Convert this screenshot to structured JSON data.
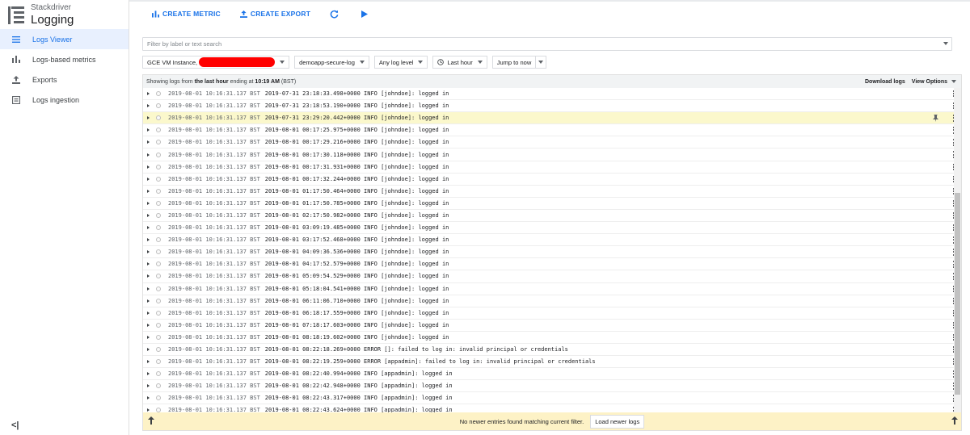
{
  "app": {
    "brand_sub": "Stackdriver",
    "brand_title": "Logging"
  },
  "sidebar": {
    "items": [
      {
        "label": "Logs Viewer",
        "icon": "list-icon",
        "active": true
      },
      {
        "label": "Logs-based metrics",
        "icon": "bar-chart-icon",
        "active": false
      },
      {
        "label": "Exports",
        "icon": "export-icon",
        "active": false
      },
      {
        "label": "Logs ingestion",
        "icon": "ingestion-icon",
        "active": false
      }
    ],
    "collapse_label": "<|"
  },
  "toolbar": {
    "create_metric": "CREATE METRIC",
    "create_export": "CREATE EXPORT"
  },
  "filter": {
    "placeholder": "Filter by label or text search"
  },
  "selects": {
    "resource": "GCE VM Instance,",
    "log": "demoapp-secure-log",
    "level": "Any log level",
    "time": "Last hour",
    "jump": "Jump to now"
  },
  "log_header": {
    "prefix": "Showing logs from",
    "range": "the last hour",
    "middle": "ending at",
    "time": "10:19 AM",
    "tz": "(BST)",
    "download": "Download logs",
    "view_options": "View Options"
  },
  "rows": [
    {
      "ts": "2019-08-01 10:16:31.137 BST",
      "msg": "2019-07-31 23:18:33.498+0000 INFO [johndoe]: logged in"
    },
    {
      "ts": "2019-08-01 10:16:31.137 BST",
      "msg": "2019-07-31 23:18:53.190+0000 INFO [johndoe]: logged in"
    },
    {
      "ts": "2019-08-01 10:16:31.137 BST",
      "msg": "2019-07-31 23:29:20.442+0000 INFO [johndoe]: logged in",
      "highlight": true
    },
    {
      "ts": "2019-08-01 10:16:31.137 BST",
      "msg": "2019-08-01 00:17:25.975+0000 INFO [johndoe]: logged in"
    },
    {
      "ts": "2019-08-01 10:16:31.137 BST",
      "msg": "2019-08-01 00:17:29.216+0000 INFO [johndoe]: logged in"
    },
    {
      "ts": "2019-08-01 10:16:31.137 BST",
      "msg": "2019-08-01 00:17:30.118+0000 INFO [johndoe]: logged in"
    },
    {
      "ts": "2019-08-01 10:16:31.137 BST",
      "msg": "2019-08-01 00:17:31.931+0000 INFO [johndoe]: logged in"
    },
    {
      "ts": "2019-08-01 10:16:31.137 BST",
      "msg": "2019-08-01 00:17:32.244+0000 INFO [johndoe]: logged in"
    },
    {
      "ts": "2019-08-01 10:16:31.137 BST",
      "msg": "2019-08-01 01:17:50.464+0000 INFO [johndoe]: logged in"
    },
    {
      "ts": "2019-08-01 10:16:31.137 BST",
      "msg": "2019-08-01 01:17:50.785+0000 INFO [johndoe]: logged in"
    },
    {
      "ts": "2019-08-01 10:16:31.137 BST",
      "msg": "2019-08-01 02:17:50.982+0000 INFO [johndoe]: logged in"
    },
    {
      "ts": "2019-08-01 10:16:31.137 BST",
      "msg": "2019-08-01 03:09:19.485+0000 INFO [johndoe]: logged in"
    },
    {
      "ts": "2019-08-01 10:16:31.137 BST",
      "msg": "2019-08-01 03:17:52.468+0000 INFO [johndoe]: logged in"
    },
    {
      "ts": "2019-08-01 10:16:31.137 BST",
      "msg": "2019-08-01 04:09:36.536+0000 INFO [johndoe]: logged in"
    },
    {
      "ts": "2019-08-01 10:16:31.137 BST",
      "msg": "2019-08-01 04:17:52.579+0000 INFO [johndoe]: logged in"
    },
    {
      "ts": "2019-08-01 10:16:31.137 BST",
      "msg": "2019-08-01 05:09:54.529+0000 INFO [johndoe]: logged in"
    },
    {
      "ts": "2019-08-01 10:16:31.137 BST",
      "msg": "2019-08-01 05:18:04.541+0000 INFO [johndoe]: logged in"
    },
    {
      "ts": "2019-08-01 10:16:31.137 BST",
      "msg": "2019-08-01 06:11:06.710+0000 INFO [johndoe]: logged in"
    },
    {
      "ts": "2019-08-01 10:16:31.137 BST",
      "msg": "2019-08-01 06:18:17.559+0000 INFO [johndoe]: logged in"
    },
    {
      "ts": "2019-08-01 10:16:31.137 BST",
      "msg": "2019-08-01 07:18:17.603+0000 INFO [johndoe]: logged in"
    },
    {
      "ts": "2019-08-01 10:16:31.137 BST",
      "msg": "2019-08-01 08:18:19.602+0000 INFO [johndoe]: logged in"
    },
    {
      "ts": "2019-08-01 10:16:31.137 BST",
      "msg": "2019-08-01 08:22:18.269+0000 ERROR []: failed to log in: invalid principal or credentials"
    },
    {
      "ts": "2019-08-01 10:16:31.137 BST",
      "msg": "2019-08-01 08:22:19.259+0000 ERROR [appadmin]: failed to log in: invalid principal or credentials"
    },
    {
      "ts": "2019-08-01 10:16:31.137 BST",
      "msg": "2019-08-01 08:22:40.994+0000 INFO [appadmin]: logged in"
    },
    {
      "ts": "2019-08-01 10:16:31.137 BST",
      "msg": "2019-08-01 08:22:42.948+0000 INFO [appadmin]: logged in"
    },
    {
      "ts": "2019-08-01 10:16:31.137 BST",
      "msg": "2019-08-01 08:22:43.317+0000 INFO [appadmin]: logged in"
    },
    {
      "ts": "2019-08-01 10:16:31.137 BST",
      "msg": "2019-08-01 08:22:43.624+0000 INFO [appadmin]: logged in"
    }
  ],
  "footer": {
    "text": "No newer entries found matching current filter.",
    "button": "Load newer logs"
  }
}
